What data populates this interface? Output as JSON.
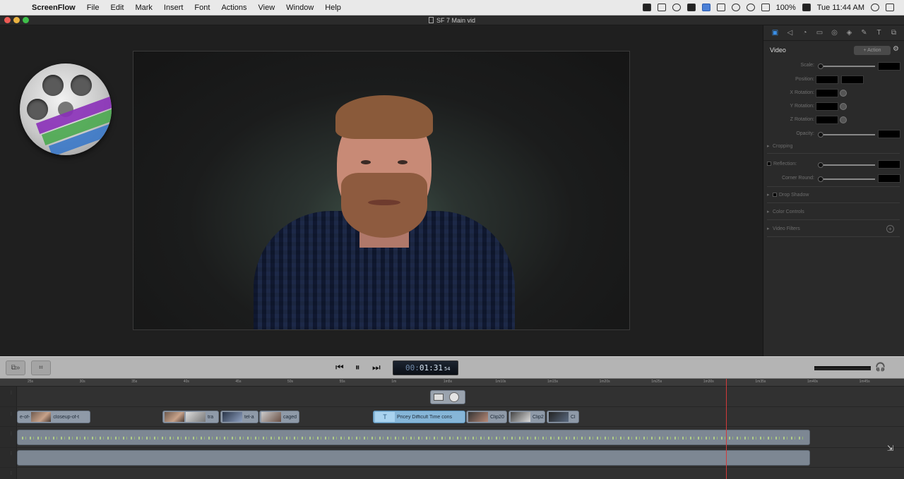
{
  "menubar": {
    "apple": "",
    "app_name": "ScreenFlow",
    "items": [
      "File",
      "Edit",
      "Mark",
      "Insert",
      "Font",
      "Actions",
      "View",
      "Window",
      "Help"
    ],
    "battery": "100%",
    "clock": "Tue 11:44 AM"
  },
  "window": {
    "title": "SF 7 Main vid"
  },
  "inspector": {
    "section_title": "Video",
    "action_button": "+ Action",
    "properties": {
      "scale": "Scale:",
      "position": "Position:",
      "x_rotation": "X Rotation:",
      "y_rotation": "Y Rotation:",
      "z_rotation": "Z Rotation:",
      "opacity": "Opacity:",
      "cropping": "Cropping",
      "reflection": "Reflection:",
      "corner_round": "Corner Round:",
      "drop_shadow": "Drop Shadow",
      "color_controls": "Color Controls",
      "video_filters": "Video Filters"
    }
  },
  "transport": {
    "timecode_prefix": "00:",
    "timecode": "01:31",
    "timecode_frames": "54"
  },
  "ruler": {
    "ticks": [
      "25s",
      "30s",
      "35s",
      "40s",
      "45s",
      "50s",
      "55s",
      "1m",
      "1m5s",
      "1m10s",
      "1m15s",
      "1m20s",
      "1m25s",
      "1m30s",
      "1m35s",
      "1m40s",
      "1m45s"
    ]
  },
  "clips": {
    "c1": "e-of-",
    "c2": "closeup-of-t",
    "c3": "tra",
    "c4": "tel-a",
    "c5": "caged",
    "text": "Pricey Difficult  Time cons",
    "c6": "Clip20",
    "c7": "Clip2",
    "c8": "Cl"
  },
  "colors": {
    "accent": "#3a8ee6",
    "playhead": "#d23a3a",
    "clip": "#8f9aa8",
    "text_clip": "#86b6d8",
    "audio_wave": "#b6d48a"
  }
}
